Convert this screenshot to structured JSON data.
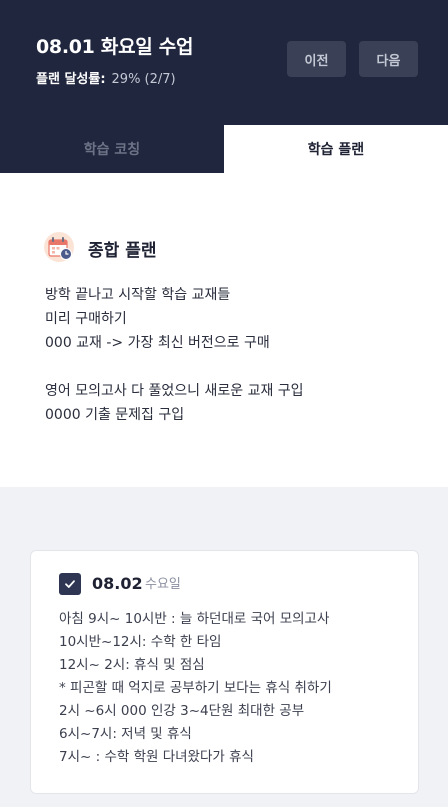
{
  "header": {
    "title": "08.01 화요일 수업",
    "rate_label": "플랜 달성률:",
    "rate_value": "29% (2/7)",
    "prev_label": "이전",
    "next_label": "다음"
  },
  "tabs": [
    {
      "label": "학습 코칭",
      "active": false
    },
    {
      "label": "학습 플랜",
      "active": true
    }
  ],
  "plan": {
    "icon": "calendar-clock-icon",
    "title": "종합 플랜",
    "lines": [
      "방학 끝나고 시작할 학습 교재들",
      "미리 구매하기",
      "000 교재 -> 가장 최신 버전으로 구매",
      "",
      "영어 모의고사 다 풀었으니 새로운 교재 구입",
      "0000 기출 문제집 구입"
    ]
  },
  "day_card": {
    "checked": true,
    "date": "08.02",
    "weekday": "수요일",
    "lines": [
      "아침 9시~ 10시반 : 늘 하던대로 국어 모의고사",
      "10시반~12시: 수학 한 타임",
      "12시~ 2시: 휴식 및 점심",
      "* 피곤할 때 억지로 공부하기 보다는 휴식 취하기",
      "2시 ~6시 000 인강 3~4단원 최대한 공부",
      "6시~7시: 저녁 및 휴식",
      "7시~ : 수학 학원 다녀왔다가 휴식"
    ]
  },
  "colors": {
    "header_bg": "#20263d",
    "button_bg": "#3a4156",
    "lower_bg": "#f1f2f5",
    "check_bg": "#2e3654"
  }
}
